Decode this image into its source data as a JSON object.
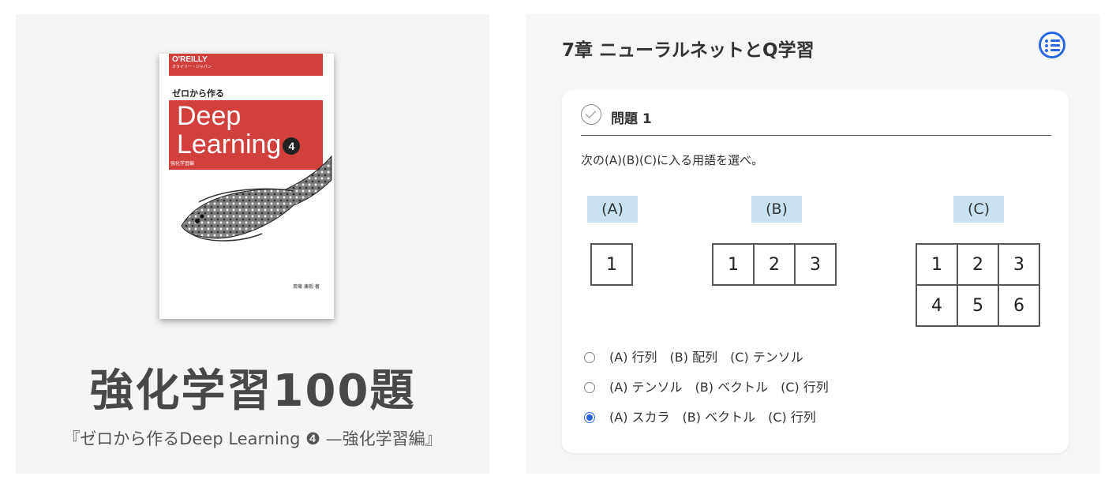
{
  "book": {
    "publisher": "O'REILLY",
    "publisher_sub": "オライリー・ジャパン",
    "pre_title": "ゼロから作る",
    "title_line1": "Deep",
    "title_line2": "Learning",
    "volume": "4",
    "cover_subtitle": "強化学習編",
    "author": "斎藤 康毅 著"
  },
  "left": {
    "title": "強化学習100題",
    "subtitle": "『ゼロから作るDeep Learning ❹ —強化学習編』"
  },
  "right": {
    "chapter_title": "7章 ニューラルネットとQ学習",
    "toc_icon": "list-icon",
    "question": {
      "label": "問題 1",
      "text": "次の(A)(B)(C)に入る用語を選べ。",
      "tags": [
        "(A)",
        "(B)",
        "(C)"
      ],
      "grid_a": [
        [
          "1"
        ]
      ],
      "grid_b": [
        [
          "1",
          "2",
          "3"
        ]
      ],
      "grid_c": [
        [
          "1",
          "2",
          "3"
        ],
        [
          "4",
          "5",
          "6"
        ]
      ],
      "options": [
        {
          "text": "(A) 行列　(B) 配列　(C) テンソル",
          "selected": false
        },
        {
          "text": "(A) テンソル　(B) ベクトル　(C) 行列",
          "selected": false
        },
        {
          "text": "(A) スカラ　(B) ベクトル　(C) 行列",
          "selected": true
        }
      ]
    }
  },
  "colors": {
    "accent": "#2a66e0",
    "cover_red": "#d2403c",
    "tag_bg": "#c8e2f2"
  }
}
